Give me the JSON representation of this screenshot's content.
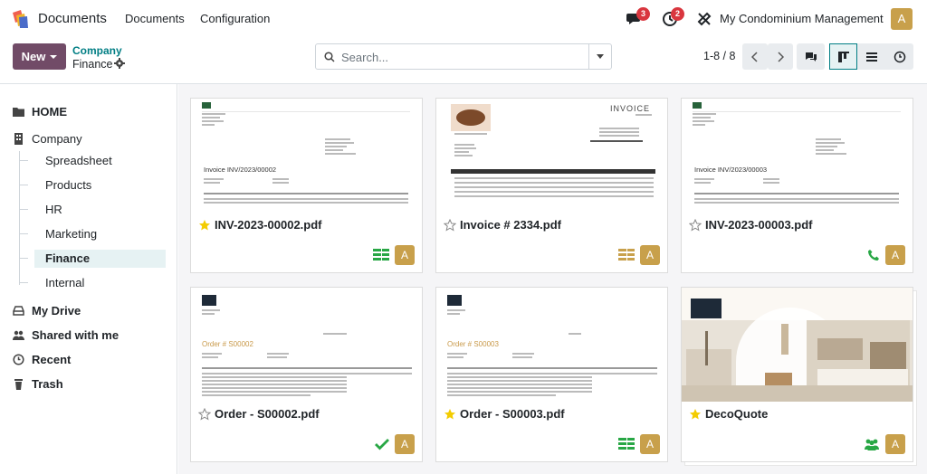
{
  "navbar": {
    "app_name": "Documents",
    "menus": [
      "Documents",
      "Configuration"
    ],
    "messages_count": "3",
    "activities_count": "2",
    "company": "My Condominium Management",
    "avatar_letter": "A"
  },
  "control": {
    "new_label": "New",
    "breadcrumb_parent": "Company",
    "breadcrumb_current": "Finance",
    "search_placeholder": "Search...",
    "pager": "1-8 / 8"
  },
  "sidebar": {
    "home": "HOME",
    "company": "Company",
    "subfolders": [
      "Spreadsheet",
      "Products",
      "HR",
      "Marketing",
      "Finance",
      "Internal"
    ],
    "active_subfolder": "Finance",
    "my_drive": "My Drive",
    "shared": "Shared with me",
    "recent": "Recent",
    "trash": "Trash"
  },
  "cards": [
    {
      "name": "INV-2023-00002.pdf",
      "starred": true,
      "status_icon": "accounting-green-icon",
      "avatar": "A",
      "preview": {
        "title": "Invoice INV/2023/00002"
      }
    },
    {
      "name": "Invoice # 2334.pdf",
      "starred": false,
      "status_icon": "accounting-gold-icon",
      "avatar": "A",
      "preview": {
        "title": "INVOICE"
      }
    },
    {
      "name": "INV-2023-00003.pdf",
      "starred": false,
      "status_icon": "phone-icon",
      "avatar": "A",
      "preview": {
        "title": "Invoice INV/2023/00003"
      }
    },
    {
      "name": "Order - S00002.pdf",
      "starred": false,
      "status_icon": "check-icon",
      "avatar": "A",
      "preview": {
        "title": "Order # S00002"
      }
    },
    {
      "name": "Order - S00003.pdf",
      "starred": true,
      "status_icon": "accounting-green-icon",
      "avatar": "A",
      "preview": {
        "title": "Order # S00003"
      }
    },
    {
      "name": "DecoQuote",
      "starred": true,
      "status_icon": "users-icon",
      "avatar": "A",
      "preview": {
        "title": ""
      }
    }
  ],
  "colors": {
    "primary": "#714b67",
    "accent": "#017e84",
    "star": "#f3cc00",
    "green": "#28a745",
    "avatar": "#c8a04b"
  }
}
